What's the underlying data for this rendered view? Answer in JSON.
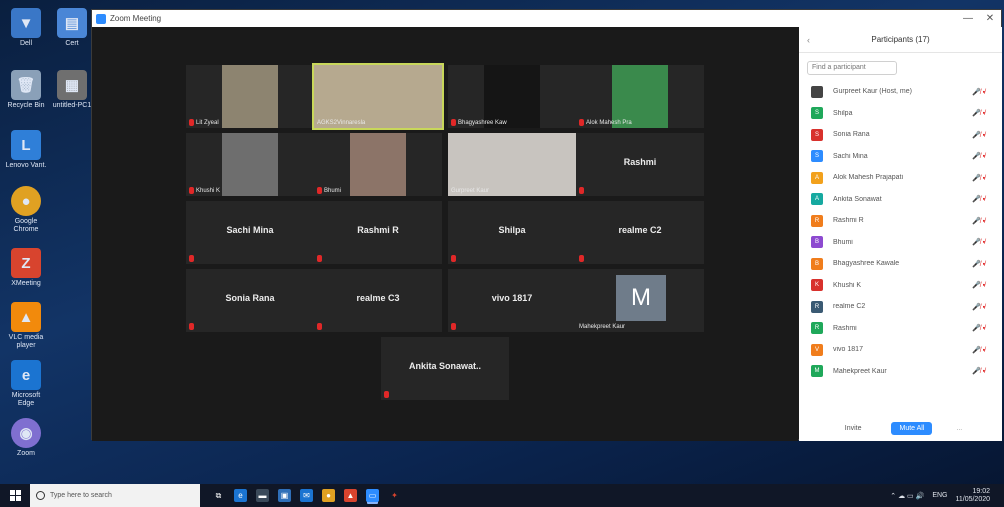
{
  "window": {
    "title": "Zoom Meeting",
    "controls": [
      "—",
      "✕"
    ]
  },
  "desktop_icons": [
    {
      "label": "Dell",
      "glyph": "▼",
      "color": "#3a77c7"
    },
    {
      "label": "Cert",
      "glyph": "▤",
      "color": "#4a86d6"
    },
    {
      "label": "Recycle Bin",
      "glyph": "🗑",
      "color": "#8aa0b8"
    },
    {
      "label": "untitled-PC1",
      "glyph": "▦",
      "color": "#6f6f6f"
    },
    {
      "label": "Lenovo Vant.",
      "glyph": "L",
      "color": "#2f7fd8"
    },
    {
      "label": "Google Chrome",
      "glyph": "●",
      "color": "#e0a122"
    },
    {
      "label": "XMeeting",
      "glyph": "Z",
      "color": "#d8442e"
    },
    {
      "label": "VLC media player",
      "glyph": "▲",
      "color": "#f28a0c"
    },
    {
      "label": "Microsoft Edge",
      "glyph": "e",
      "color": "#1b74d1"
    },
    {
      "label": "Zoom",
      "glyph": "◉",
      "color": "#7f6fd0"
    }
  ],
  "tiles": [
    {
      "name": "",
      "caption": "Lit Zyeal",
      "video": "#8d8470",
      "mic_off": true
    },
    {
      "name": "",
      "caption": "AGKS2Vinnaresla",
      "video": "#b6a98f",
      "mic_off": false,
      "active": true
    },
    {
      "name": "",
      "caption": "Bhagyashree Kaw",
      "video": "#151515",
      "mic_off": true
    },
    {
      "name": "",
      "caption": "Alok Mahesh Pra",
      "video": "#3a8a4c",
      "mic_off": true
    },
    {
      "name": "",
      "caption": "Khushi K",
      "video": "#6e6e6e",
      "mic_off": true
    },
    {
      "name": "",
      "caption": "Bhumi",
      "video": "#8c7468",
      "mic_off": true
    },
    {
      "name": "",
      "caption": "Gurpreet Kaur",
      "video": "#c8c4bf",
      "mic_off": false
    },
    {
      "name": "Rashmi",
      "caption": "",
      "video": "",
      "mic_off": true
    },
    {
      "name": "Sachi Mina",
      "caption": "",
      "video": "",
      "mic_off": true
    },
    {
      "name": "Rashmi R",
      "caption": "",
      "video": "",
      "mic_off": true
    },
    {
      "name": "Shilpa",
      "caption": "",
      "video": "",
      "mic_off": true
    },
    {
      "name": "realme C2",
      "caption": "",
      "video": "",
      "mic_off": true
    },
    {
      "name": "Sonia Rana",
      "caption": "",
      "video": "",
      "mic_off": true
    },
    {
      "name": "realme C3",
      "caption": "",
      "video": "",
      "mic_off": true
    },
    {
      "name": "vivo 1817",
      "caption": "",
      "video": "",
      "mic_off": true
    },
    {
      "name": "",
      "caption": "Mahekpreet Kaur",
      "video": "",
      "mic_off": false,
      "avatar": "M"
    },
    {
      "name": "Ankita  Sonawat..",
      "caption": "",
      "video": "",
      "mic_off": true
    }
  ],
  "panel": {
    "title": "Participants (17)",
    "back": "‹",
    "search_placeholder": "Find a participant",
    "participants": [
      {
        "name": "Gurpreet Kaur (Host, me)",
        "initial": "",
        "color": "#444444"
      },
      {
        "name": "Shilpa",
        "initial": "S",
        "color": "#1fa85a"
      },
      {
        "name": "Sonia Rana",
        "initial": "S",
        "color": "#d8312c"
      },
      {
        "name": "Sachi Mina",
        "initial": "S",
        "color": "#2d8cff"
      },
      {
        "name": "Alok Mahesh Prajapati",
        "initial": "A",
        "color": "#f2a11c"
      },
      {
        "name": "Ankita Sonawat",
        "initial": "A",
        "color": "#16a9a0"
      },
      {
        "name": "Rashmi R",
        "initial": "R",
        "color": "#f07d1c"
      },
      {
        "name": "Bhumi",
        "initial": "B",
        "color": "#8d4ad0"
      },
      {
        "name": "Bhagyashree Kawale",
        "initial": "B",
        "color": "#f07d1c"
      },
      {
        "name": "Khushi K",
        "initial": "K",
        "color": "#d8312c"
      },
      {
        "name": "realme C2",
        "initial": "R",
        "color": "#3a5a73"
      },
      {
        "name": "Rashmi",
        "initial": "R",
        "color": "#1fa85a"
      },
      {
        "name": "vivo 1817",
        "initial": "V",
        "color": "#f07d1c"
      },
      {
        "name": "Mahekpreet Kaur",
        "initial": "M",
        "color": "#1fa85a"
      }
    ],
    "icons": "🎤̸ ▪̸",
    "footer": {
      "invite": "Invite",
      "mute_all": "Mute All",
      "more": "..."
    }
  },
  "taskbar": {
    "search_placeholder": "Type here to search",
    "apps": [
      {
        "glyph": "⧉",
        "color": "#ffffff",
        "bg": "transparent"
      },
      {
        "glyph": "e",
        "color": "#ffffff",
        "bg": "#1b74d1"
      },
      {
        "glyph": "▬",
        "color": "#ffffff",
        "bg": "#3b4a5a"
      },
      {
        "glyph": "▣",
        "color": "#ffffff",
        "bg": "#2f6fb8"
      },
      {
        "glyph": "✉",
        "color": "#ffffff",
        "bg": "#1b74d1"
      },
      {
        "glyph": "●",
        "color": "#ffffff",
        "bg": "#e0a122"
      },
      {
        "glyph": "▲",
        "color": "#ffffff",
        "bg": "#d8442e"
      },
      {
        "glyph": "▭",
        "color": "#ffffff",
        "bg": "#2d8cff",
        "active": true
      },
      {
        "glyph": "✦",
        "color": "#d8442e",
        "bg": "transparent"
      }
    ],
    "tray_text": "ENG",
    "time": "19:02",
    "date": "11/05/2020"
  }
}
